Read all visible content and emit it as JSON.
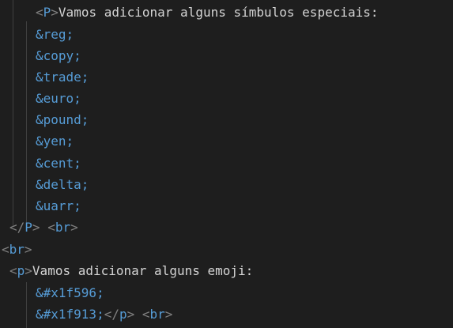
{
  "editor": {
    "lines": [
      {
        "parts": [
          {
            "kind": "bracket",
            "text": "<"
          },
          {
            "kind": "tag",
            "text": "P"
          },
          {
            "kind": "bracket",
            "text": ">"
          },
          {
            "kind": "text",
            "text": "Vamos adicionar alguns símbulos especiais:"
          }
        ]
      },
      {
        "parts": [
          {
            "kind": "entity",
            "text": "&reg;"
          }
        ]
      },
      {
        "parts": [
          {
            "kind": "entity",
            "text": "&copy;"
          }
        ]
      },
      {
        "parts": [
          {
            "kind": "entity",
            "text": "&trade;"
          }
        ]
      },
      {
        "parts": [
          {
            "kind": "entity",
            "text": "&euro;"
          }
        ]
      },
      {
        "parts": [
          {
            "kind": "entity",
            "text": "&pound;"
          }
        ]
      },
      {
        "parts": [
          {
            "kind": "entity",
            "text": "&yen;"
          }
        ]
      },
      {
        "parts": [
          {
            "kind": "entity",
            "text": "&cent;"
          }
        ]
      },
      {
        "parts": [
          {
            "kind": "entity",
            "text": "&delta;"
          }
        ]
      },
      {
        "parts": [
          {
            "kind": "entity",
            "text": "&uarr;"
          }
        ]
      },
      {
        "parts": [
          {
            "kind": "bracket",
            "text": "</"
          },
          {
            "kind": "tag",
            "text": "P"
          },
          {
            "kind": "bracket",
            "text": ">"
          },
          {
            "kind": "text",
            "text": " "
          },
          {
            "kind": "bracket",
            "text": "<"
          },
          {
            "kind": "tag",
            "text": "br"
          },
          {
            "kind": "bracket",
            "text": ">"
          }
        ]
      },
      {
        "parts": [
          {
            "kind": "bracket",
            "text": "<"
          },
          {
            "kind": "tag",
            "text": "br"
          },
          {
            "kind": "bracket",
            "text": ">"
          }
        ]
      },
      {
        "parts": [
          {
            "kind": "bracket",
            "text": "<"
          },
          {
            "kind": "tag",
            "text": "p"
          },
          {
            "kind": "bracket",
            "text": ">"
          },
          {
            "kind": "text",
            "text": "Vamos adicionar alguns emoji:"
          }
        ]
      },
      {
        "parts": [
          {
            "kind": "entity",
            "text": "&#x1f596;"
          }
        ]
      },
      {
        "parts": [
          {
            "kind": "entity",
            "text": "&#x1f913;"
          },
          {
            "kind": "bracket",
            "text": "</"
          },
          {
            "kind": "tag",
            "text": "p"
          },
          {
            "kind": "bracket",
            "text": ">"
          },
          {
            "kind": "text",
            "text": " "
          },
          {
            "kind": "bracket",
            "text": "<"
          },
          {
            "kind": "tag",
            "text": "br"
          },
          {
            "kind": "bracket",
            "text": ">"
          }
        ]
      }
    ]
  },
  "colors": {
    "background": "#1e1e1e",
    "bracket": "#808080",
    "tag": "#569cd6",
    "entity": "#569cd6",
    "text": "#d4d4d4",
    "indent_guide": "#404040"
  }
}
